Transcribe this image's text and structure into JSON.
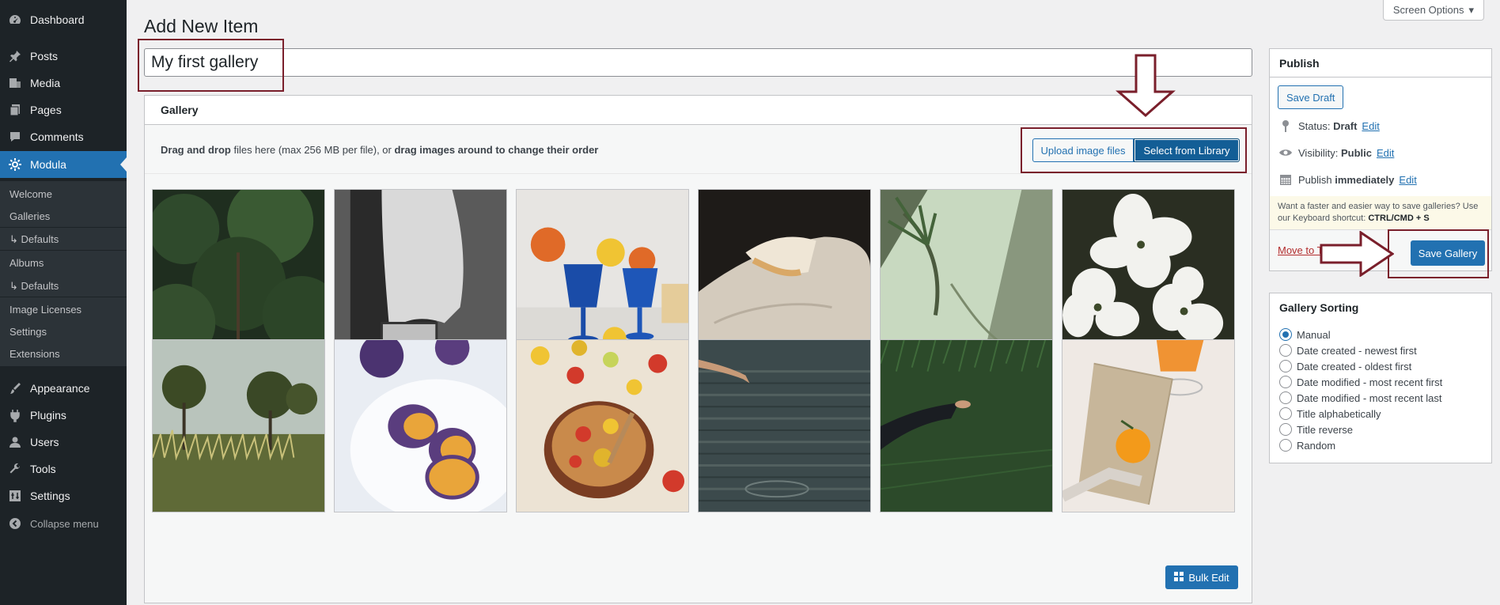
{
  "sidebar": {
    "items": [
      {
        "label": "Dashboard",
        "icon": "dashboard-icon"
      },
      {
        "label": "Posts",
        "icon": "pin-icon"
      },
      {
        "label": "Media",
        "icon": "media-icon"
      },
      {
        "label": "Pages",
        "icon": "page-icon"
      },
      {
        "label": "Comments",
        "icon": "comment-icon"
      },
      {
        "label": "Modula",
        "icon": "gear-icon"
      },
      {
        "label": "Appearance",
        "icon": "brush-icon"
      },
      {
        "label": "Plugins",
        "icon": "plug-icon"
      },
      {
        "label": "Users",
        "icon": "user-icon"
      },
      {
        "label": "Tools",
        "icon": "wrench-icon"
      },
      {
        "label": "Settings",
        "icon": "settings-icon"
      }
    ],
    "submenu": [
      {
        "label": "Welcome"
      },
      {
        "label": "Galleries"
      },
      {
        "label": "↳ Defaults"
      },
      {
        "label": "Albums"
      },
      {
        "label": "↳ Defaults"
      },
      {
        "label": "Image Licenses"
      },
      {
        "label": "Settings"
      },
      {
        "label": "Extensions"
      }
    ],
    "collapse_label": "Collapse menu"
  },
  "header": {
    "title": "Add New Item",
    "screen_options": "Screen Options"
  },
  "title_input": {
    "value": "My first gallery"
  },
  "gallery": {
    "heading": "Gallery",
    "drop_bold1": "Drag and drop",
    "drop_text1": " files here (max 256 MB per file), or ",
    "drop_bold2": "drag images around to change their order",
    "upload_label": "Upload image files",
    "library_label": "Select from Library",
    "bulk_edit_label": "Bulk Edit"
  },
  "publish": {
    "title": "Publish",
    "save_draft": "Save Draft",
    "status_label": "Status: ",
    "status_value": "Draft",
    "visibility_label": "Visibility: ",
    "visibility_value": "Public",
    "publish_label": "Publish ",
    "publish_value": "immediately",
    "edit_link": "Edit",
    "note_text": "Want a faster and easier way to save galleries? Use our Keyboard shortcut: ",
    "note_shortcut": "CTRL/CMD + S",
    "move_trash": "Move to Trash",
    "save_gallery": "Save Gallery"
  },
  "sorting": {
    "title": "Gallery Sorting",
    "options": [
      {
        "label": "Manual",
        "checked": true
      },
      {
        "label": "Date created - newest first",
        "checked": false
      },
      {
        "label": "Date created - oldest first",
        "checked": false
      },
      {
        "label": "Date modified - most recent first",
        "checked": false
      },
      {
        "label": "Date modified - most recent last",
        "checked": false
      },
      {
        "label": "Title alphabetically",
        "checked": false
      },
      {
        "label": "Title reverse",
        "checked": false
      },
      {
        "label": "Random",
        "checked": false
      }
    ]
  },
  "colors": {
    "sidebar_bg": "#1d2327",
    "accent": "#2271b1",
    "annotation": "#7a1f2b"
  }
}
